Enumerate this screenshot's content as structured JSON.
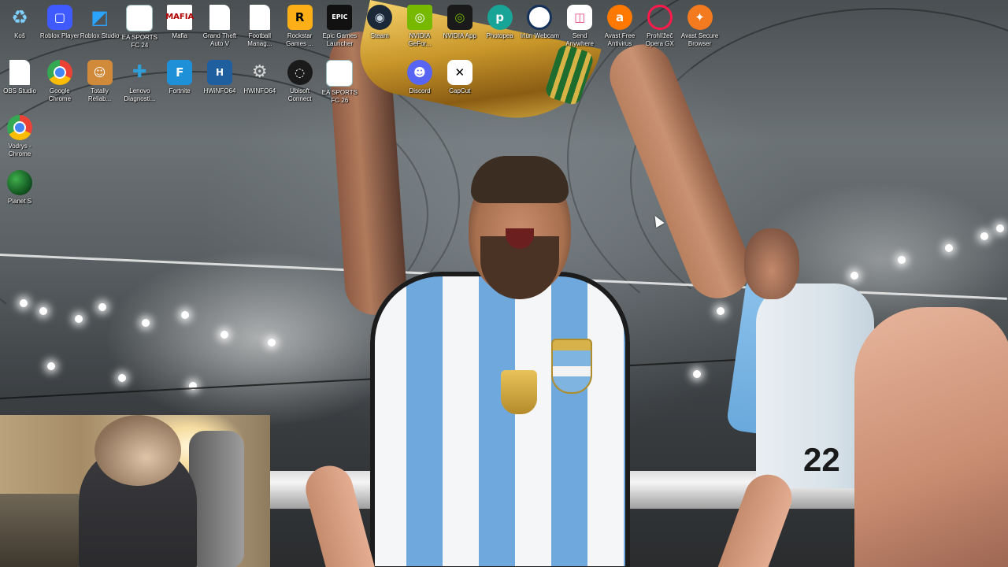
{
  "desktop": {
    "icons": [
      {
        "label": "Koš",
        "icon": "recycle-bin-icon",
        "glyph": "♻",
        "style": "img-recycle",
        "col": 0,
        "row": 0
      },
      {
        "label": "Roblox Player",
        "icon": "roblox-player-icon",
        "glyph": "▢",
        "style": "img-robloxplayer",
        "col": 1,
        "row": 0
      },
      {
        "label": "Roblox Studio",
        "icon": "roblox-studio-icon",
        "glyph": "◩",
        "style": "img-robloxstudio",
        "col": 2,
        "row": 0
      },
      {
        "label": "EA SPORTS FC 24",
        "icon": "ea-sports-fc24-icon",
        "glyph": "",
        "style": "img-easports",
        "col": 3,
        "row": 0
      },
      {
        "label": "Mafia",
        "icon": "mafia-icon",
        "glyph": "MAFIA",
        "style": "img-mafia",
        "col": 4,
        "row": 0
      },
      {
        "label": "Grand Theft Auto V",
        "icon": "file-icon",
        "glyph": "",
        "style": "img-file",
        "col": 5,
        "row": 0
      },
      {
        "label": "Football Manag...",
        "icon": "file-icon",
        "glyph": "",
        "style": "img-file",
        "col": 6,
        "row": 0
      },
      {
        "label": "Rockstar Games ...",
        "icon": "rockstar-icon",
        "glyph": "R",
        "style": "img-rockstar",
        "col": 7,
        "row": 0
      },
      {
        "label": "Epic Games Launcher",
        "icon": "epic-games-icon",
        "glyph": "EPIC",
        "style": "img-epic",
        "col": 8,
        "row": 0
      },
      {
        "label": "Steam",
        "icon": "steam-icon",
        "glyph": "◉",
        "style": "img-steam",
        "col": 9,
        "row": 0
      },
      {
        "label": "NVIDIA GeFor...",
        "icon": "nvidia-geforce-icon",
        "glyph": "◎",
        "style": "img-nvidia",
        "col": 10,
        "row": 0
      },
      {
        "label": "NVIDIA App",
        "icon": "nvidia-app-icon",
        "glyph": "◎",
        "style": "img-nvidia-app",
        "col": 11,
        "row": 0
      },
      {
        "label": "Photopea",
        "icon": "photopea-icon",
        "glyph": "p",
        "style": "img-photopea",
        "col": 12,
        "row": 0
      },
      {
        "label": "Iriun Webcam",
        "icon": "iriun-webcam-icon",
        "glyph": "",
        "style": "img-iriun",
        "col": 13,
        "row": 0
      },
      {
        "label": "Send Anywhere",
        "icon": "send-anywhere-icon",
        "glyph": "◫",
        "style": "img-sendanywhere",
        "col": 14,
        "row": 0
      },
      {
        "label": "Avast Free Antivirus",
        "icon": "avast-antivirus-icon",
        "glyph": "a",
        "style": "img-avast",
        "col": 15,
        "row": 0
      },
      {
        "label": "Prohlížeč Opera GX",
        "icon": "opera-gx-icon",
        "glyph": "",
        "style": "img-opera",
        "col": 16,
        "row": 0
      },
      {
        "label": "Avast Secure Browser",
        "icon": "avast-browser-icon",
        "glyph": "✦",
        "style": "img-avastbrowser",
        "col": 17,
        "row": 0
      },
      {
        "label": "OBS Studio",
        "icon": "file-icon",
        "glyph": "",
        "style": "img-obs",
        "col": 0,
        "row": 1
      },
      {
        "label": "Google Chrome",
        "icon": "chrome-icon",
        "glyph": "",
        "style": "img-chrome",
        "col": 1,
        "row": 1
      },
      {
        "label": "Totally Reliab...",
        "icon": "totally-reliable-icon",
        "glyph": "☺",
        "style": "img-totally",
        "col": 2,
        "row": 1
      },
      {
        "label": "Lenovo Diagnosti...",
        "icon": "lenovo-diagnostics-icon",
        "glyph": "✚",
        "style": "img-lenovo",
        "col": 3,
        "row": 1
      },
      {
        "label": "Fortnite",
        "icon": "fortnite-icon",
        "glyph": "F",
        "style": "img-fortnite",
        "col": 4,
        "row": 1
      },
      {
        "label": "HWiNFO64",
        "icon": "hwinfo64-icon",
        "glyph": "H",
        "style": "img-hwinfo",
        "col": 5,
        "row": 1
      },
      {
        "label": "HWiNFO64",
        "icon": "hwinfo64-icon",
        "glyph": "⚙",
        "style": "img-hwinfo2",
        "col": 6,
        "row": 1
      },
      {
        "label": "Ubisoft Connect",
        "icon": "ubisoft-icon",
        "glyph": "◌",
        "style": "img-ubisoft",
        "col": 7,
        "row": 1
      },
      {
        "label": "EA SPORTS FC 26",
        "icon": "ea-sports-fc26-icon",
        "glyph": "",
        "style": "img-easports26",
        "col": 8,
        "row": 1
      },
      {
        "label": "Discord",
        "icon": "discord-icon",
        "glyph": "☻",
        "style": "img-discord",
        "col": 10,
        "row": 1
      },
      {
        "label": "CapCut",
        "icon": "capcut-icon",
        "glyph": "✕",
        "style": "img-capcut",
        "col": 11,
        "row": 1
      },
      {
        "label": "Vodrys - Chrome",
        "icon": "chrome-icon",
        "glyph": "",
        "style": "img-chrome",
        "col": 0,
        "row": 2
      },
      {
        "label": "Planet S",
        "icon": "planet-s-icon",
        "glyph": "",
        "style": "img-planet",
        "col": 0,
        "row": 3
      }
    ]
  },
  "wallpaper": {
    "jersey_numbers": "22"
  }
}
